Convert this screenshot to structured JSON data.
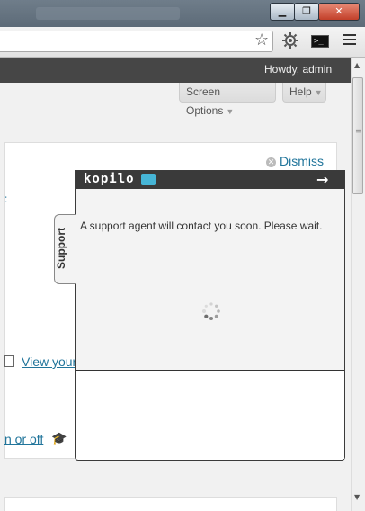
{
  "window": {
    "minimize_glyph": "▁",
    "maximize_glyph": "❐",
    "close_glyph": "✕"
  },
  "toolbar": {
    "star_icon": "star-icon",
    "settings_icon": "gear-icon",
    "terminal_label": ">_",
    "menu_icon": "hamburger-menu-icon"
  },
  "admin_bar": {
    "greeting": "Howdy, admin"
  },
  "screen_meta": {
    "screen_options_label": "Screen Options",
    "help_label": "Help",
    "caret": "▼"
  },
  "welcome_panel": {
    "dismiss_label": "Dismiss",
    "view_your_link": "View your",
    "on_off_link": "n or off"
  },
  "chat_widget": {
    "brand": "kopilo",
    "close_arrow": "→",
    "message": "A support agent will contact you soon. Please wait.",
    "tab_label": "Support",
    "colors": {
      "header": "#3a3a3a",
      "brand_icon": "#46b5d6"
    }
  }
}
